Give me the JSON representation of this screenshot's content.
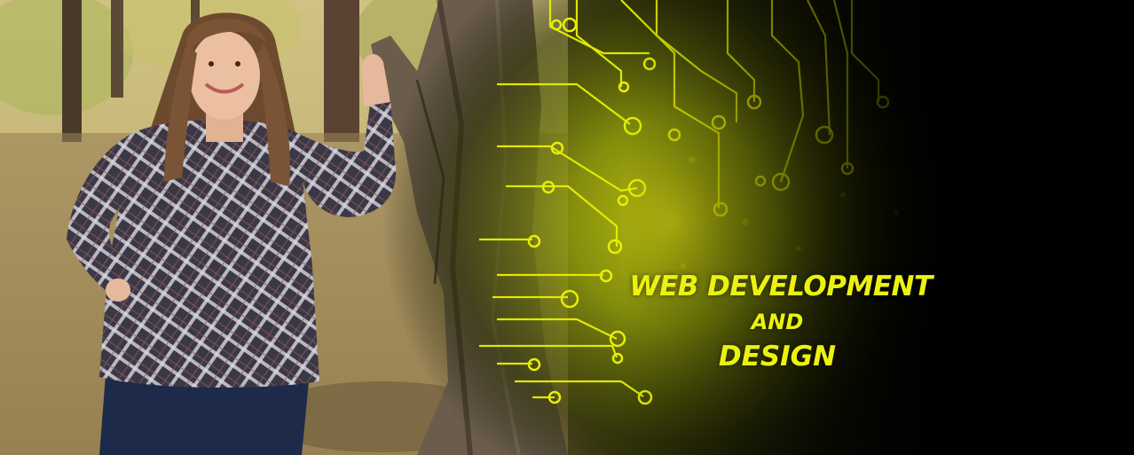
{
  "hero": {
    "headline": {
      "line1": "WEB DEVELOPMENT",
      "line2": "AND",
      "line3": "DESIGN"
    }
  },
  "colors": {
    "accent": "#ecf20f",
    "circuit": "#e8f000",
    "background": "#000000"
  },
  "icons": [
    "circuit-board-graphic"
  ]
}
